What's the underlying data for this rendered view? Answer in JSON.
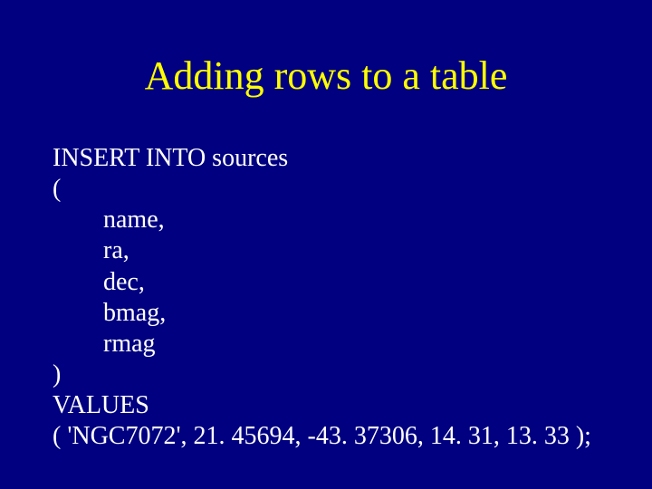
{
  "title": "Adding rows to a table",
  "code": {
    "l1": "INSERT INTO sources",
    "l2": "(",
    "l3": "        name,",
    "l4": "        ra,",
    "l5": "        dec,",
    "l6": "        bmag,",
    "l7": "        rmag",
    "l8": ")",
    "l9": "VALUES",
    "l10": "( 'NGC7072', 21. 45694, -43. 37306, 14. 31, 13. 33 );"
  }
}
